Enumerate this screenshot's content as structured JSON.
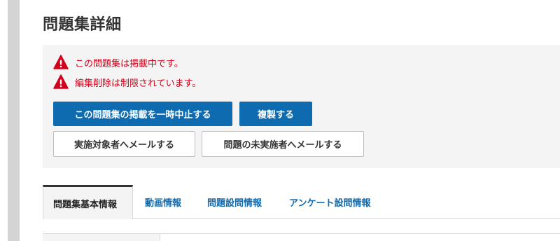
{
  "page": {
    "title": "問題集詳細"
  },
  "notices": [
    {
      "icon": "warning-icon",
      "text": "この問題集は掲載中です。"
    },
    {
      "icon": "warning-icon",
      "text": "編集削除は制限されています。"
    }
  ],
  "actions": {
    "suspend_label": "この問題集の掲載を一時中止する",
    "duplicate_label": "複製する",
    "mail_targets_label": "実施対象者へメールする",
    "mail_unfinished_label": "問題の未実施者へメールする"
  },
  "tabs": [
    {
      "label": "問題集基本情報",
      "active": true
    },
    {
      "label": "動画情報",
      "active": false
    },
    {
      "label": "問題設問情報",
      "active": false
    },
    {
      "label": "アンケート設問情報",
      "active": false
    }
  ],
  "colors": {
    "primary": "#0f6bb0",
    "warning": "#d0021b",
    "panel_bg": "#f4f4f4",
    "side_bar": "#d4d4d4"
  }
}
